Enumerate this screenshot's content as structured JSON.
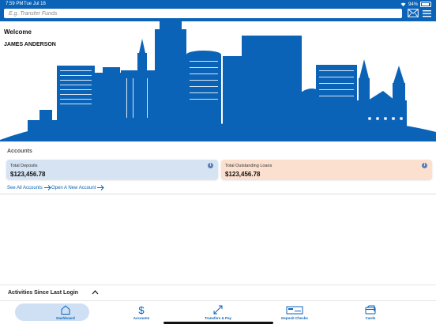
{
  "status_bar": {
    "time": "7:59 PM",
    "date": "Tue Jul 18",
    "battery": "94%"
  },
  "search": {
    "placeholder": "E.g. Transfer Funds"
  },
  "hero": {
    "welcome": "Welcome",
    "user_name": "JAMES ANDERSON"
  },
  "accounts": {
    "title": "Accounts",
    "cards": [
      {
        "label": "Total Deposits",
        "amount": "$123,456.78"
      },
      {
        "label": "Total Outstanding Loans",
        "amount": "$123,456.78"
      }
    ],
    "links": {
      "see_all": "See All Accounts",
      "open_new": "Open A New Account"
    }
  },
  "activities": {
    "label": "Activities Since Last Login"
  },
  "tabs": [
    {
      "label": "Dashboard",
      "icon": "home-icon"
    },
    {
      "label": "Accounts",
      "icon": "dollar-icon"
    },
    {
      "label": "Transfers & Pay",
      "icon": "transfer-arrows-icon"
    },
    {
      "label": "Deposit Checks",
      "icon": "check-icon"
    },
    {
      "label": "Cards",
      "icon": "cards-icon"
    }
  ],
  "colors": {
    "brand": "#0b63b8",
    "deposit_card": "#d6e3f3",
    "loan_card": "#fbe0cf",
    "active_tab": "#cfe0f4"
  }
}
